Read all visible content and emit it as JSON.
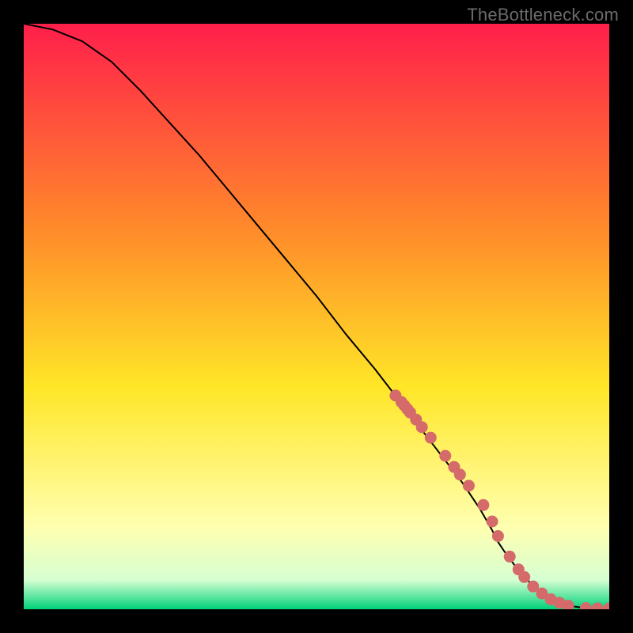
{
  "watermark": "TheBottleneck.com",
  "colors": {
    "gradient_top": "#ff1f4b",
    "gradient_mid1": "#ff8a2a",
    "gradient_mid2": "#ffe627",
    "gradient_mid3": "#ffffb0",
    "gradient_bot_fade": "#d6ffd2",
    "gradient_bot": "#00d27a",
    "curve": "#000000",
    "marker": "#d46a6a",
    "frame_bg": "#000000"
  },
  "chart_data": {
    "type": "line",
    "title": "",
    "xlabel": "",
    "ylabel": "",
    "xlim": [
      0,
      100
    ],
    "ylim": [
      0,
      100
    ],
    "grid": false,
    "legend": false,
    "series": [
      {
        "name": "bottleneck-curve",
        "x": [
          0,
          5,
          10,
          15,
          20,
          25,
          30,
          35,
          40,
          45,
          50,
          55,
          60,
          65,
          70,
          75,
          78,
          80,
          81,
          82,
          84,
          86,
          88,
          90,
          93,
          96,
          98,
          100
        ],
        "y": [
          100,
          99,
          97,
          93.5,
          88.5,
          83,
          77.5,
          71.5,
          65.5,
          59.5,
          53.5,
          47,
          41,
          34.5,
          28,
          21.5,
          17,
          13.5,
          11.5,
          10,
          7.3,
          5,
          3.2,
          1.7,
          0.6,
          0.2,
          0.15,
          0.15
        ]
      }
    ],
    "markers": {
      "name": "highlight-points",
      "x": [
        63.5,
        64.5,
        65,
        65.5,
        66,
        67,
        68,
        69.5,
        72,
        73.5,
        74.5,
        76,
        78.5,
        80,
        81,
        83,
        84.5,
        85.5,
        87,
        88.5,
        90,
        91.5,
        93,
        96,
        98,
        100
      ],
      "y": [
        36.5,
        35.4,
        34.8,
        34.2,
        33.6,
        32.4,
        31.1,
        29.3,
        26.2,
        24.3,
        23,
        21.1,
        17.8,
        15,
        12.5,
        9,
        6.8,
        5.5,
        3.9,
        2.7,
        1.7,
        1.1,
        0.6,
        0.2,
        0.15,
        0.15
      ]
    }
  }
}
